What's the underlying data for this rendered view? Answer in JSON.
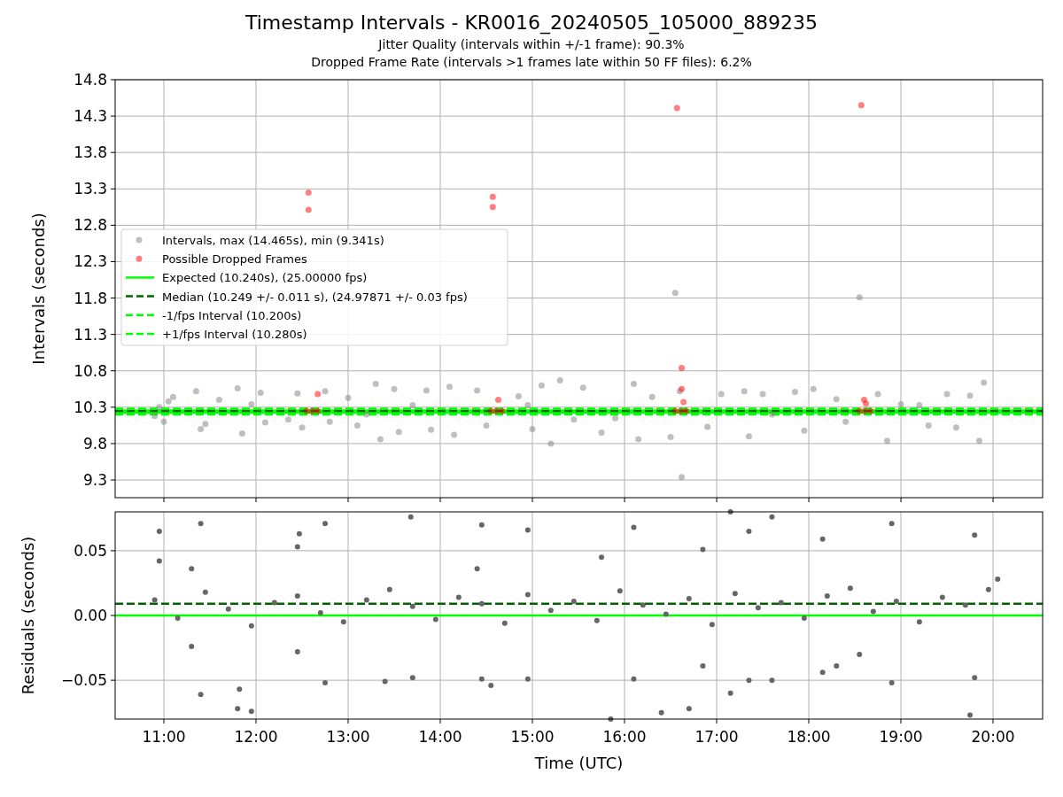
{
  "title": "Timestamp Intervals - KR0016_20240505_105000_889235",
  "subtitles": [
    "Jitter Quality (intervals within +/-1 frame): 90.3%",
    "Dropped Frame Rate (intervals >1 frames late within 50 FF files): 6.2%"
  ],
  "intervals_panel": {
    "chart_data": {
      "type": "scatter",
      "grid": true,
      "legend": "center left",
      "ylabel": "Intervals (seconds)",
      "xlim": [
        10.471,
        20.538
      ],
      "ylim": [
        9.057,
        14.8
      ],
      "yticks": [
        {
          "value": 9.3,
          "label": "9.3"
        },
        {
          "value": 9.8,
          "label": "9.8"
        },
        {
          "value": 10.3,
          "label": "10.3"
        },
        {
          "value": 10.8,
          "label": "10.8"
        },
        {
          "value": 11.3,
          "label": "11.3"
        },
        {
          "value": 11.8,
          "label": "11.8"
        },
        {
          "value": 12.3,
          "label": "12.3"
        },
        {
          "value": 12.8,
          "label": "12.8"
        },
        {
          "value": 13.3,
          "label": "13.3"
        },
        {
          "value": 13.8,
          "label": "13.8"
        },
        {
          "value": 14.3,
          "label": "14.3"
        },
        {
          "value": 14.8,
          "label": "14.8"
        }
      ],
      "series": [
        {
          "name": "Intervals, max (14.465s), min (9.341s)",
          "type": "scatter",
          "color": "#808080",
          "x": [
            10.9,
            10.95,
            11.0,
            11.05,
            11.1,
            11.35,
            11.4,
            11.45,
            11.6,
            11.8,
            11.85,
            11.95,
            12.05,
            12.1,
            12.35,
            12.45,
            12.5,
            12.75,
            12.8,
            13.0,
            13.1,
            13.2,
            13.3,
            13.35,
            13.5,
            13.55,
            13.7,
            13.85,
            13.9,
            14.1,
            14.15,
            14.4,
            14.5,
            14.85,
            14.95,
            15.0,
            15.1,
            15.2,
            15.3,
            15.45,
            15.55,
            15.75,
            15.9,
            16.1,
            16.15,
            16.3,
            16.5,
            16.55,
            16.6,
            16.62,
            16.9,
            17.05,
            17.3,
            17.35,
            17.5,
            17.6,
            17.85,
            17.95,
            18.05,
            18.3,
            18.4,
            18.55,
            18.75,
            18.85,
            19.0,
            19.2,
            19.3,
            19.5,
            19.6,
            19.75,
            19.85,
            19.9
          ],
          "values": [
            10.18,
            10.3,
            10.1,
            10.38,
            10.44,
            10.52,
            10.0,
            10.07,
            10.4,
            10.56,
            9.94,
            10.34,
            10.5,
            10.09,
            10.13,
            10.49,
            10.02,
            10.52,
            10.1,
            10.43,
            10.05,
            10.2,
            10.62,
            9.86,
            10.55,
            9.96,
            10.33,
            10.53,
            9.99,
            10.58,
            9.92,
            10.53,
            10.05,
            10.45,
            10.33,
            10.0,
            10.6,
            9.8,
            10.67,
            10.13,
            10.57,
            9.95,
            10.15,
            10.62,
            9.86,
            10.44,
            9.89,
            11.87,
            10.52,
            9.34,
            10.03,
            10.48,
            10.52,
            9.9,
            10.48,
            10.2,
            10.51,
            9.98,
            10.55,
            10.41,
            10.1,
            11.81,
            10.48,
            9.84,
            10.34,
            10.33,
            10.05,
            10.48,
            10.02,
            10.46,
            9.84,
            10.64
          ]
        },
        {
          "name": "Possible Dropped Frames",
          "type": "scatter",
          "color": "#ff0000",
          "x": [
            12.55,
            12.61,
            12.67,
            12.57,
            12.57,
            12.67,
            14.55,
            14.61,
            14.67,
            14.57,
            14.57,
            14.63,
            16.55,
            16.61,
            16.67,
            16.57,
            16.62,
            16.62,
            16.64,
            18.55,
            18.61,
            18.67,
            18.57,
            18.6,
            18.62
          ],
          "values": [
            10.25,
            10.25,
            10.25,
            13.25,
            13.01,
            10.48,
            10.25,
            10.25,
            10.25,
            13.19,
            13.05,
            10.4,
            10.25,
            10.25,
            10.25,
            14.41,
            10.84,
            10.55,
            10.37,
            10.25,
            10.25,
            10.25,
            14.45,
            10.4,
            10.35
          ]
        },
        {
          "name": "Expected (10.240s), (25.00000 fps)",
          "type": "line",
          "line_style": "solid",
          "color": "#00ff00",
          "x": [
            10.471,
            20.538
          ],
          "values": [
            10.24,
            10.24
          ]
        },
        {
          "name": "Median (10.249 +/- 0.011 s), (24.97871 +/- 0.03 fps)",
          "type": "line",
          "line_style": "dashed",
          "color": "#006400",
          "x": [
            10.471,
            20.538
          ],
          "values": [
            10.249,
            10.249
          ]
        },
        {
          "name": "-1/fps Interval (10.200s)",
          "type": "line",
          "line_style": "dashed",
          "color": "#00ff00",
          "x": [
            10.471,
            20.538
          ],
          "values": [
            10.2,
            10.2
          ]
        },
        {
          "name": "+1/fps Interval (10.280s)",
          "type": "line",
          "line_style": "dashed",
          "color": "#00ff00",
          "x": [
            10.471,
            20.538
          ],
          "values": [
            10.28,
            10.28
          ]
        }
      ]
    }
  },
  "residuals_panel": {
    "chart_data": {
      "type": "scatter",
      "grid": true,
      "xlabel": "Time (UTC)",
      "ylabel": "Residuals (seconds)",
      "xlim": [
        10.471,
        20.538
      ],
      "ylim": [
        -0.08,
        0.08
      ],
      "xticks": [
        {
          "value": 11,
          "label": "11:00"
        },
        {
          "value": 12,
          "label": "12:00"
        },
        {
          "value": 13,
          "label": "13:00"
        },
        {
          "value": 14,
          "label": "14:00"
        },
        {
          "value": 15,
          "label": "15:00"
        },
        {
          "value": 16,
          "label": "16:00"
        },
        {
          "value": 17,
          "label": "17:00"
        },
        {
          "value": 18,
          "label": "18:00"
        },
        {
          "value": 19,
          "label": "19:00"
        },
        {
          "value": 20,
          "label": "20:00"
        }
      ],
      "yticks": [
        {
          "value": -0.05,
          "label": "−0.05"
        },
        {
          "value": 0,
          "label": "0.00"
        },
        {
          "value": 0.05,
          "label": "0.05"
        }
      ],
      "series": [
        {
          "type": "scatter",
          "color": "#666666",
          "x": [
            10.95,
            10.95,
            11.3,
            11.3,
            11.4,
            11.4,
            11.8,
            11.82,
            11.95,
            12.45,
            12.47,
            12.45,
            12.75,
            12.75,
            13.4,
            13.68,
            13.7,
            14.4,
            14.45,
            14.45,
            14.55,
            14.95,
            14.95,
            15.75,
            15.85,
            16.1,
            16.1,
            16.4,
            16.7,
            16.85,
            16.85,
            17.15,
            17.15,
            17.35,
            17.35,
            17.6,
            17.6,
            18.15,
            18.15,
            18.3,
            18.55,
            18.9,
            18.9,
            19.75,
            19.8,
            19.8,
            10.9,
            11.15,
            11.45,
            11.7,
            11.95,
            12.2,
            12.45,
            12.7,
            12.95,
            13.2,
            13.45,
            13.7,
            13.95,
            14.2,
            14.45,
            14.7,
            14.95,
            15.2,
            15.45,
            15.7,
            15.95,
            16.2,
            16.45,
            16.7,
            16.95,
            17.2,
            17.45,
            17.7,
            17.95,
            18.2,
            18.45,
            18.7,
            18.95,
            19.2,
            19.45,
            19.7,
            19.95,
            20.05
          ],
          "values": [
            0.065,
            0.042,
            0.036,
            -0.024,
            0.071,
            -0.061,
            -0.072,
            -0.057,
            -0.074,
            0.053,
            0.063,
            -0.028,
            0.071,
            -0.052,
            -0.051,
            0.076,
            -0.048,
            0.036,
            0.07,
            -0.049,
            -0.054,
            0.066,
            -0.049,
            0.045,
            -0.08,
            0.068,
            -0.049,
            -0.075,
            -0.072,
            0.051,
            -0.039,
            0.08,
            -0.06,
            0.065,
            -0.05,
            0.076,
            -0.05,
            0.059,
            -0.044,
            -0.039,
            -0.03,
            0.071,
            -0.052,
            -0.077,
            0.062,
            -0.048,
            0.012,
            -0.002,
            0.018,
            0.005,
            -0.008,
            0.01,
            0.015,
            0.002,
            -0.005,
            0.012,
            0.02,
            0.007,
            -0.003,
            0.014,
            0.009,
            -0.006,
            0.016,
            0.004,
            0.011,
            -0.004,
            0.019,
            0.008,
            0.001,
            0.013,
            -0.007,
            0.017,
            0.006,
            0.01,
            -0.002,
            0.015,
            0.021,
            0.003,
            0.011,
            -0.005,
            0.014,
            0.008,
            0.02,
            0.028
          ]
        },
        {
          "type": "line",
          "line_style": "solid",
          "color": "#00ff00",
          "x": [
            10.471,
            20.538
          ],
          "values": [
            0,
            0
          ]
        },
        {
          "type": "line",
          "line_style": "dashed",
          "color": "#006400",
          "x": [
            10.471,
            20.538
          ],
          "values": [
            0.009,
            0.009
          ]
        }
      ]
    }
  }
}
